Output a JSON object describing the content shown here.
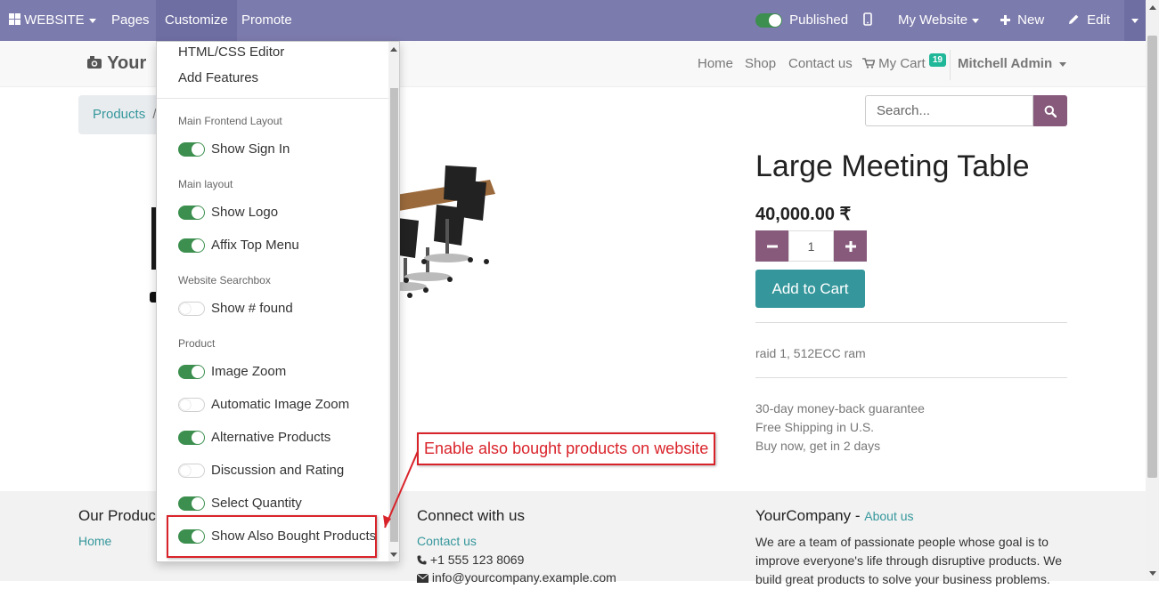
{
  "topbar": {
    "website_label": "WEBSITE",
    "pages_label": "Pages",
    "customize_label": "Customize",
    "promote_label": "Promote",
    "published_label": "Published",
    "my_website_label": "My Website",
    "new_label": "New",
    "edit_label": "Edit"
  },
  "header": {
    "logo_text": "Your",
    "nav": [
      "Home",
      "Shop",
      "Contact us"
    ],
    "cart_label": "My Cart",
    "cart_count": "19",
    "user_name": "Mitchell Admin"
  },
  "breadcrumb": {
    "first": "Products",
    "separator": "/"
  },
  "search": {
    "placeholder": "Search..."
  },
  "product": {
    "name": "Large Meeting Table",
    "price": "40,000.00 ₹",
    "quantity": "1",
    "add_to_cart_label": "Add to Cart",
    "description": "raid 1, 512ECC ram",
    "terms": [
      "30-day money-back guarantee",
      "Free Shipping in U.S.",
      "Buy now, get in 2 days"
    ]
  },
  "customize_menu": {
    "items": [
      "HTML/CSS Editor",
      "Add Features"
    ],
    "sections": [
      {
        "title": "Main Frontend Layout",
        "options": [
          {
            "label": "Show Sign In",
            "on": true
          }
        ]
      },
      {
        "title": "Main layout",
        "options": [
          {
            "label": "Show Logo",
            "on": true
          },
          {
            "label": "Affix Top Menu",
            "on": true
          }
        ]
      },
      {
        "title": "Website Searchbox",
        "options": [
          {
            "label": "Show # found",
            "on": false
          }
        ]
      },
      {
        "title": "Product",
        "options": [
          {
            "label": "Image Zoom",
            "on": true
          },
          {
            "label": "Automatic Image Zoom",
            "on": false
          },
          {
            "label": "Alternative Products",
            "on": true
          },
          {
            "label": "Discussion and Rating",
            "on": false
          },
          {
            "label": "Select Quantity",
            "on": true
          },
          {
            "label": "Show Also Bought Products",
            "on": true
          }
        ]
      }
    ]
  },
  "annotation": {
    "text": "Enable also bought products on website"
  },
  "footer": {
    "col1_title": "Our Produc",
    "col1_link": "Home",
    "col2_title": "Connect with us",
    "col2_contact": "Contact us",
    "col2_phone": "+1 555 123 8069",
    "col2_email": "info@yourcompany.example.com",
    "col3_title": "YourCompany",
    "col3_sep": "-",
    "col3_about": "About us",
    "col3_text_lines": [
      "We are a team of passionate people whose goal is to",
      "improve everyone's life through disruptive products. We",
      "build great products to solve your business problems."
    ]
  },
  "colors": {
    "topbar": "#7c7bad",
    "primary": "#875a7b",
    "teal": "#35979c",
    "toggle_on": "#3c8f4e",
    "annotation": "#d9232a"
  }
}
